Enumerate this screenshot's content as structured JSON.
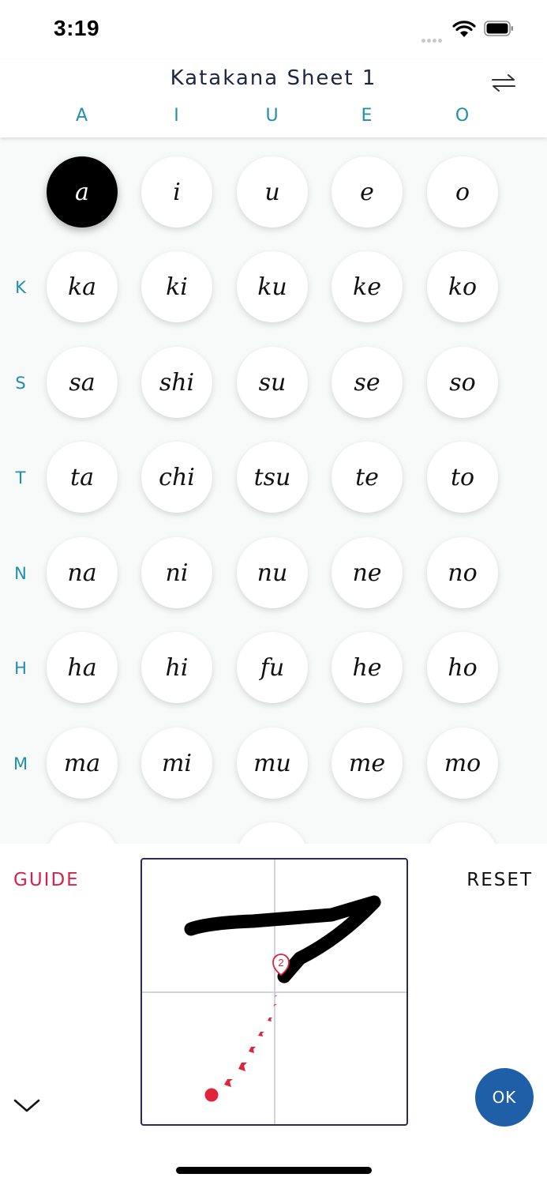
{
  "status": {
    "time": "3:19"
  },
  "header": {
    "title": "Katakana Sheet 1",
    "swap_icon": "swap-arrows-icon"
  },
  "columns": [
    "A",
    "I",
    "U",
    "E",
    "O"
  ],
  "rows": [
    {
      "label": "",
      "cells": [
        "a",
        "i",
        "u",
        "e",
        "o"
      ]
    },
    {
      "label": "K",
      "cells": [
        "ka",
        "ki",
        "ku",
        "ke",
        "ko"
      ]
    },
    {
      "label": "S",
      "cells": [
        "sa",
        "shi",
        "su",
        "se",
        "so"
      ]
    },
    {
      "label": "T",
      "cells": [
        "ta",
        "chi",
        "tsu",
        "te",
        "to"
      ]
    },
    {
      "label": "N",
      "cells": [
        "na",
        "ni",
        "nu",
        "ne",
        "no"
      ]
    },
    {
      "label": "H",
      "cells": [
        "ha",
        "hi",
        "fu",
        "he",
        "ho"
      ]
    },
    {
      "label": "M",
      "cells": [
        "ma",
        "mi",
        "mu",
        "me",
        "mo"
      ]
    }
  ],
  "selected": "a",
  "panel": {
    "guide_label": "GUIDE",
    "reset_label": "RESET",
    "ok_label": "OK",
    "stroke_number": "2",
    "collapse_icon": "chevron-down-icon"
  },
  "colors": {
    "accent": "#1f8fae",
    "guide": "#d3244b",
    "ok": "#1f5fa8",
    "stroke_hint": "#e0243a"
  }
}
